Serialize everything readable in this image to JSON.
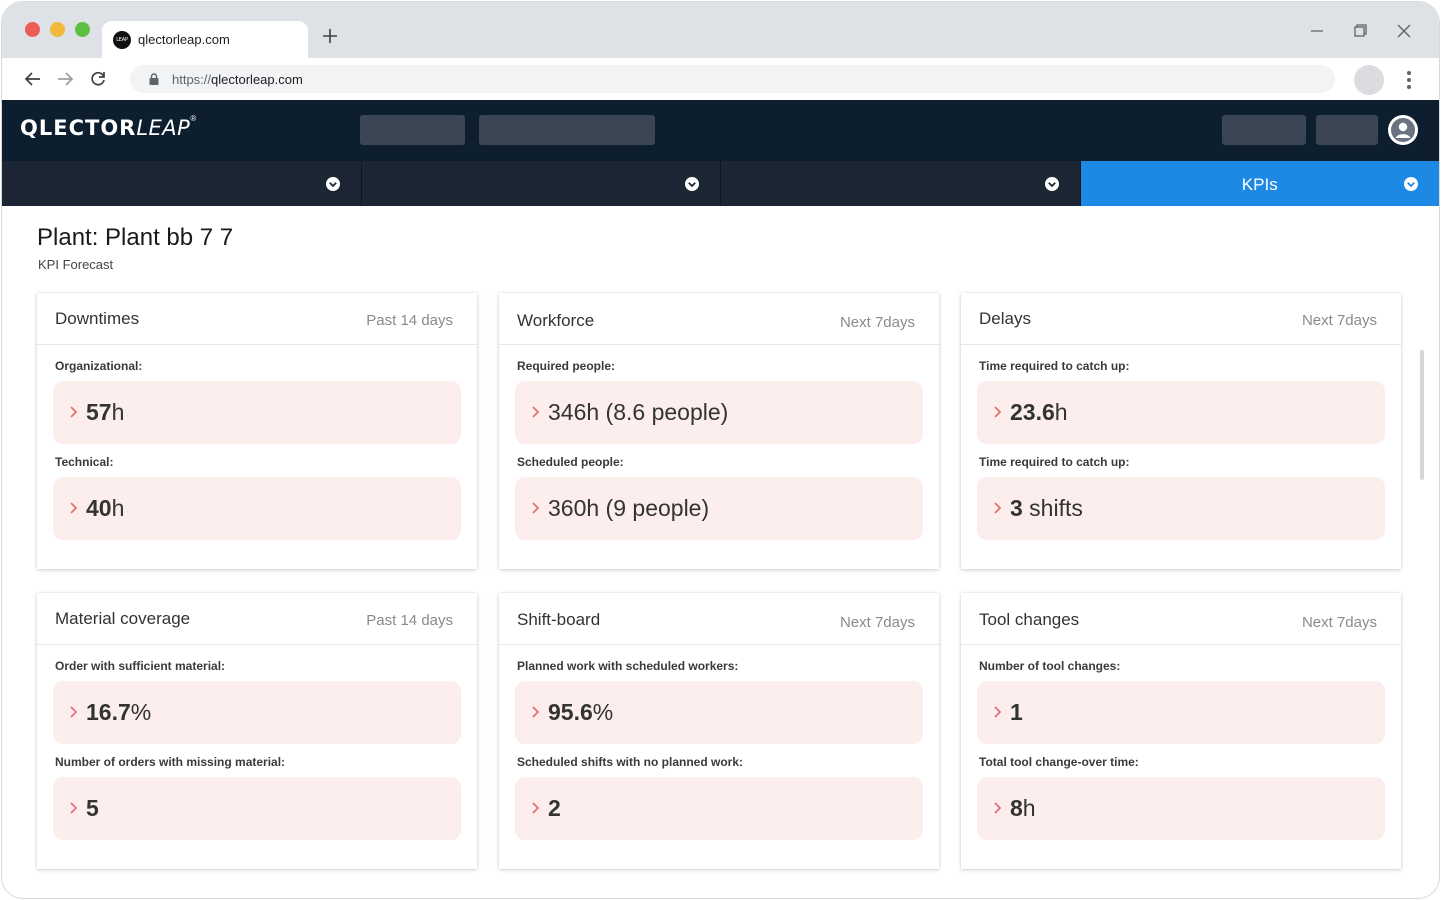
{
  "browser": {
    "tab_title": "qlectorleap.com",
    "favicon_text": "LEAP",
    "url_scheme": "https://",
    "url_host": "qlectorleap.com"
  },
  "app": {
    "logo_bold": "QLECTOR",
    "logo_light": "LEAP",
    "logo_mark": "®"
  },
  "modules": [
    {
      "label": ""
    },
    {
      "label": ""
    },
    {
      "label": ""
    },
    {
      "label": "KPIs",
      "active": true
    }
  ],
  "page": {
    "title": "Plant: Plant bb 7 7",
    "subtitle": "KPI Forecast"
  },
  "cards": [
    {
      "title": "Downtimes",
      "period": "Past 14 days",
      "metrics": [
        {
          "label": "Organizational:",
          "value_bold": "57",
          "value_rest": "h"
        },
        {
          "label": "Technical:",
          "value_bold": "40",
          "value_rest": "h"
        }
      ]
    },
    {
      "title": "Workforce",
      "period": "Next 7days",
      "metrics": [
        {
          "label": "Required people:",
          "value_bold": "",
          "value_rest": "346h (8.6 people)"
        },
        {
          "label": "Scheduled people:",
          "value_bold": "",
          "value_rest": "360h (9 people)"
        }
      ]
    },
    {
      "title": "Delays",
      "period": "Next 7days",
      "metrics": [
        {
          "label": "Time required to catch up:",
          "value_bold": "23.6",
          "value_rest": "h"
        },
        {
          "label": "Time required to catch up:",
          "value_bold": "3",
          "value_rest": " shifts"
        }
      ]
    },
    {
      "title": "Material coverage",
      "period": "Past 14 days",
      "metrics": [
        {
          "label": "Order with sufficient material:",
          "value_bold": "16.7",
          "value_rest": "%"
        },
        {
          "label": "Number of orders with missing material:",
          "value_bold": "5",
          "value_rest": ""
        }
      ]
    },
    {
      "title": "Shift-board",
      "period": "Next 7days",
      "metrics": [
        {
          "label": "Planned work with scheduled workers:",
          "value_bold": "95.6",
          "value_rest": "%"
        },
        {
          "label": "Scheduled shifts with no planned work:",
          "value_bold": "2",
          "value_rest": ""
        }
      ]
    },
    {
      "title": "Tool changes",
      "period": "Next 7days",
      "metrics": [
        {
          "label": "Number of tool changes:",
          "value_bold": "1",
          "value_rest": ""
        },
        {
          "label": "Total tool change-over time:",
          "value_bold": "8",
          "value_rest": "h"
        }
      ]
    }
  ],
  "colors": {
    "header_bg": "#0d1e2f",
    "module_bg": "#1b2533",
    "active_module": "#1e88e5",
    "metric_bg": "#fdeeee",
    "metric_arrow": "#e57373"
  }
}
